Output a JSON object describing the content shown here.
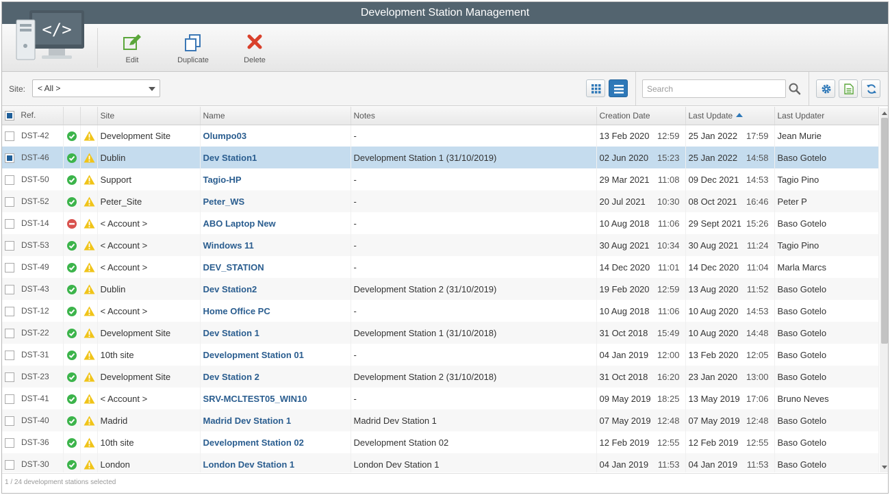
{
  "window": {
    "title": "Development Station Management"
  },
  "toolbar": {
    "edit_label": "Edit",
    "duplicate_label": "Duplicate",
    "delete_label": "Delete"
  },
  "filter": {
    "site_label": "Site:",
    "site_value": "< All >"
  },
  "search": {
    "placeholder": "Search"
  },
  "icons": {
    "app_logo": "monitor-code-icon",
    "edit": "pencil-icon",
    "duplicate": "copy-icon",
    "delete": "x-icon",
    "grid_view": "grid-icon",
    "list_view": "list-icon",
    "search": "magnifier-icon",
    "settings": "gear-icon",
    "export": "spreadsheet-icon",
    "refresh": "refresh-icon",
    "status_ok": "check-circle-icon",
    "status_disabled": "minus-circle-icon",
    "warning": "warning-triangle-icon"
  },
  "colors": {
    "title_bar": "#53646f",
    "accent": "#2e78b8",
    "link": "#2a5d8f",
    "selected_row": "#c5dcee",
    "status_ok": "#3cb44b",
    "status_disabled": "#d9534f",
    "warning": "#f0c419"
  },
  "table": {
    "columns": {
      "ref": "Ref.",
      "site": "Site",
      "name": "Name",
      "notes": "Notes",
      "creation_date": "Creation Date",
      "last_update": "Last Update",
      "last_updater": "Last Updater"
    },
    "sort_column": "last_update",
    "rows": [
      {
        "ref": "DST-42",
        "status": "ok",
        "site": "Development Site",
        "name": "Olumpo03",
        "notes": "-",
        "created_date": "13 Feb 2020",
        "created_time": "12:59",
        "updated_date": "25 Jan 2022",
        "updated_time": "17:59",
        "updater": "Jean Murie",
        "selected": false
      },
      {
        "ref": "DST-46",
        "status": "ok",
        "site": "Dublin",
        "name": "Dev Station1",
        "notes": "Development Station 1 (31/10/2019)",
        "created_date": "02 Jun 2020",
        "created_time": "15:23",
        "updated_date": "25 Jan 2022",
        "updated_time": "14:58",
        "updater": "Baso Gotelo",
        "selected": true
      },
      {
        "ref": "DST-50",
        "status": "ok",
        "site": "Support",
        "name": "Tagio-HP",
        "notes": "-",
        "created_date": "29 Mar 2021",
        "created_time": "11:08",
        "updated_date": "09 Dec 2021",
        "updated_time": "14:53",
        "updater": "Tagio Pino",
        "selected": false
      },
      {
        "ref": "DST-52",
        "status": "ok",
        "site": "Peter_Site",
        "name": "Peter_WS",
        "notes": "-",
        "created_date": "20 Jul 2021",
        "created_time": "10:30",
        "updated_date": "08 Oct 2021",
        "updated_time": "16:46",
        "updater": "Peter P",
        "selected": false
      },
      {
        "ref": "DST-14",
        "status": "disabled",
        "site": "< Account >",
        "name": "ABO Laptop New",
        "notes": "-",
        "created_date": "10 Aug 2018",
        "created_time": "11:06",
        "updated_date": "29 Sept 2021",
        "updated_time": "15:26",
        "updater": "Baso Gotelo",
        "selected": false
      },
      {
        "ref": "DST-53",
        "status": "ok",
        "site": "< Account >",
        "name": "Windows 11",
        "notes": "-",
        "created_date": "30 Aug 2021",
        "created_time": "10:34",
        "updated_date": "30 Aug 2021",
        "updated_time": "11:24",
        "updater": "Tagio Pino",
        "selected": false
      },
      {
        "ref": "DST-49",
        "status": "ok",
        "site": "< Account >",
        "name": "DEV_STATION",
        "notes": "-",
        "created_date": "14 Dec 2020",
        "created_time": "11:01",
        "updated_date": "14 Dec 2020",
        "updated_time": "11:04",
        "updater": "Marla Marcs",
        "selected": false
      },
      {
        "ref": "DST-43",
        "status": "ok",
        "site": "Dublin",
        "name": "Dev Station2",
        "notes": "Development Station 2 (31/10/2019)",
        "created_date": "19 Feb 2020",
        "created_time": "12:59",
        "updated_date": "13 Aug 2020",
        "updated_time": "11:52",
        "updater": "Baso Gotelo",
        "selected": false
      },
      {
        "ref": "DST-12",
        "status": "ok",
        "site": "< Account >",
        "name": "Home Office PC",
        "notes": "-",
        "created_date": "10 Aug 2018",
        "created_time": "11:06",
        "updated_date": "10 Aug 2020",
        "updated_time": "14:53",
        "updater": "Baso Gotelo",
        "selected": false
      },
      {
        "ref": "DST-22",
        "status": "ok",
        "site": "Development Site",
        "name": "Dev Station 1",
        "notes": "Development Station 1 (31/10/2018)",
        "created_date": "31 Oct 2018",
        "created_time": "15:49",
        "updated_date": "10 Aug 2020",
        "updated_time": "14:48",
        "updater": "Baso Gotelo",
        "selected": false
      },
      {
        "ref": "DST-31",
        "status": "ok",
        "site": "10th site",
        "name": "Development Station 01",
        "notes": "-",
        "created_date": "04 Jan 2019",
        "created_time": "12:00",
        "updated_date": "13 Feb 2020",
        "updated_time": "12:05",
        "updater": "Baso Gotelo",
        "selected": false
      },
      {
        "ref": "DST-23",
        "status": "ok",
        "site": "Development Site",
        "name": "Dev Station 2",
        "notes": "Development Station 2 (31/10/2018)",
        "created_date": "31 Oct 2018",
        "created_time": "16:20",
        "updated_date": "23 Jan 2020",
        "updated_time": "13:00",
        "updater": "Baso Gotelo",
        "selected": false
      },
      {
        "ref": "DST-41",
        "status": "ok",
        "site": "< Account >",
        "name": "SRV-MCLTEST05_WIN10",
        "notes": "-",
        "created_date": "09 May 2019",
        "created_time": "18:25",
        "updated_date": "13 May 2019",
        "updated_time": "17:06",
        "updater": "Bruno Neves",
        "selected": false
      },
      {
        "ref": "DST-40",
        "status": "ok",
        "site": "Madrid",
        "name": "Madrid Dev Station 1",
        "notes": "Madrid Dev Station 1",
        "created_date": "07 May 2019",
        "created_time": "12:48",
        "updated_date": "07 May 2019",
        "updated_time": "12:48",
        "updater": "Baso Gotelo",
        "selected": false
      },
      {
        "ref": "DST-36",
        "status": "ok",
        "site": "10th site",
        "name": "Development Station 02",
        "notes": "Development Station 02",
        "created_date": "12 Feb 2019",
        "created_time": "12:55",
        "updated_date": "12 Feb 2019",
        "updated_time": "12:55",
        "updater": "Baso Gotelo",
        "selected": false
      },
      {
        "ref": "DST-30",
        "status": "ok",
        "site": "London",
        "name": "London Dev Station 1",
        "notes": "London Dev Station 1",
        "created_date": "04 Jan 2019",
        "created_time": "11:53",
        "updated_date": "04 Jan 2019",
        "updated_time": "11:53",
        "updater": "Baso Gotelo",
        "selected": false
      }
    ]
  },
  "status": {
    "selection_text": "1 / 24 development stations selected"
  }
}
